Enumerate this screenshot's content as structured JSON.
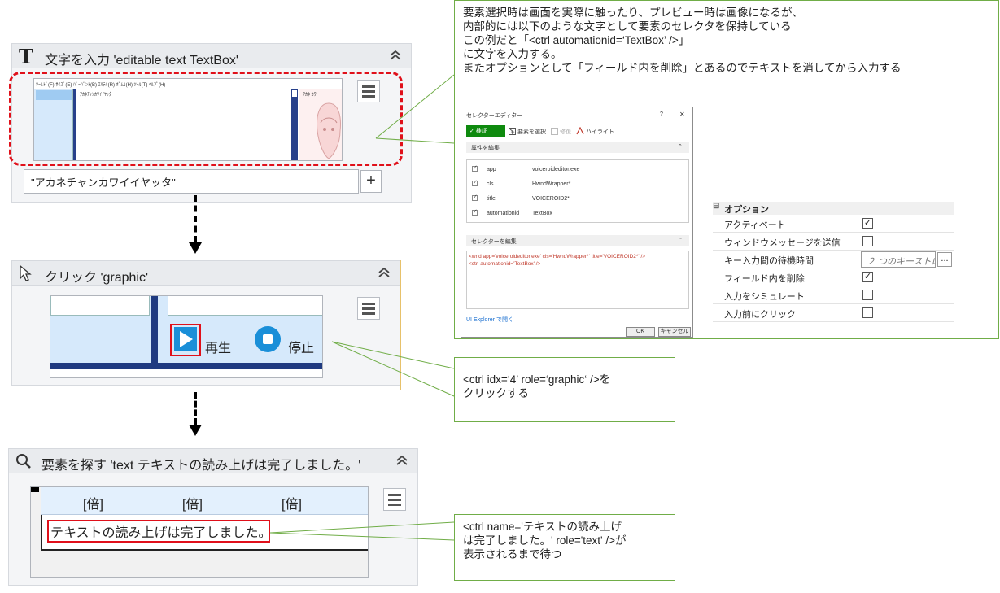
{
  "activities": {
    "type_into": {
      "title": "文字を入力 'editable text  TextBox'",
      "icon": "T",
      "input_value": "\"アカネチャンカワイイヤッタ\"",
      "plus_label": "+",
      "mini_menu": "ｿｰﾙﾄﾞ(F)  ｻｲｽﾞ(E)  ﾊﾞｰﾊﾞﾝﾄ(B)  ｴﾘﾃﾙ(R)  ﾎﾞﾑﾙ(H)  ﾂｰﾙ(T)  ﾍﾙﾌﾟ(H)",
      "mini_text": "ｱｶﾈﾁｬﾝｶﾜｲｲﾔｯﾀ",
      "mini_side": "ｱｶﾈ ｶﾜ"
    },
    "click": {
      "title": "クリック 'graphic'",
      "play_label": "再生",
      "stop_label": "停止"
    },
    "find": {
      "title": "要素を探す 'text  テキストの読み上げは完了しました。'",
      "col1": "[倍]",
      "col2": "[倍]",
      "col3": "[倍]",
      "status_text": "テキストの読み上げは完了しました。"
    }
  },
  "callouts": {
    "top": "要素選択時は画面を実際に触ったり、プレビュー時は画像になるが、\n内部的には以下のような文字として要素のセレクタを保持している\nこの例だと「<ctrl automationid=‘TextBox’ />」\nに文字を入力する。\nまたオプションとして「フィールド内を削除」とあるのでテキストを消してから入力する",
    "click": "<ctrl idx=‘4’ role=‘graphic‘ />を\nクリックする",
    "find": "<ctrl name='テキストの読み上げ\nは完了しました。' role='text' />が\n表示されるまで待つ"
  },
  "selector_editor": {
    "title": "セレクターエディター",
    "help": "?",
    "close": "✕",
    "validate": "✓ 検証",
    "select_element": "要素を選択",
    "repair": "修復",
    "highlight": "ハイライト",
    "attributes_header": "属性を編集",
    "attributes": [
      {
        "name": "app",
        "value": "voiceroideditor.exe",
        "checked": true
      },
      {
        "name": "cls",
        "value": "HwndWrapper*",
        "checked": true
      },
      {
        "name": "title",
        "value": "VOICEROID2*",
        "checked": true
      },
      {
        "name": "automationid",
        "value": "TextBox",
        "checked": true
      }
    ],
    "selector_header": "セレクターを編集",
    "selector_line1": "<wnd app='voiceroideditor.exe' cls='HwndWrapper*' title='VOICEROID2*' />",
    "selector_line2": "<ctrl automationid='TextBox' />",
    "ui_explorer": "UI Explorer で開く",
    "ok": "OK",
    "cancel": "キャンセル"
  },
  "options": {
    "header": "オプション",
    "rows": [
      {
        "label": "アクティベート",
        "type": "check",
        "checked": true
      },
      {
        "label": "ウィンドウメッセージを送信",
        "type": "check",
        "checked": false
      },
      {
        "label": "キー入力間の待機時間",
        "type": "text",
        "placeholder": "２ つのキーストロ-",
        "button": "..."
      },
      {
        "label": "フィールド内を削除",
        "type": "check",
        "checked": true
      },
      {
        "label": "入力をシミュレート",
        "type": "check",
        "checked": false
      },
      {
        "label": "入力前にクリック",
        "type": "check",
        "checked": false
      }
    ]
  }
}
